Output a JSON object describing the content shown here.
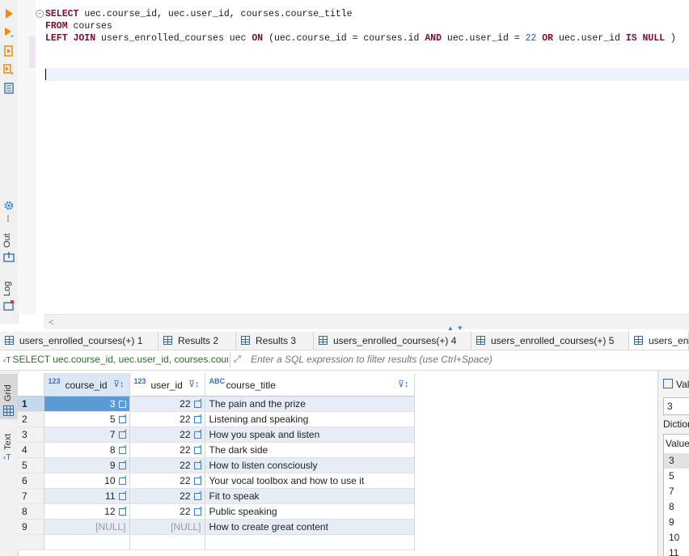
{
  "editor": {
    "sql": [
      {
        "tokens": [
          {
            "t": "SELECT",
            "k": "kw"
          },
          {
            "t": " uec.course_id, uec.user_id, courses.course_title",
            "k": ""
          }
        ]
      },
      {
        "tokens": [
          {
            "t": "FROM",
            "k": "kw"
          },
          {
            "t": " courses",
            "k": ""
          }
        ]
      },
      {
        "tokens": [
          {
            "t": "LEFT JOIN",
            "k": "kw"
          },
          {
            "t": " users_enrolled_courses uec ",
            "k": ""
          },
          {
            "t": "ON",
            "k": "kw"
          },
          {
            "t": " (uec.course_id = courses.id ",
            "k": ""
          },
          {
            "t": "AND",
            "k": "kw"
          },
          {
            "t": " uec.user_id = ",
            "k": ""
          },
          {
            "t": "22",
            "k": "num"
          },
          {
            "t": " ",
            "k": ""
          },
          {
            "t": "OR",
            "k": "kw"
          },
          {
            "t": " uec.user_id ",
            "k": ""
          },
          {
            "t": "IS",
            "k": "kw"
          },
          {
            "t": " ",
            "k": ""
          },
          {
            "t": "NULL",
            "k": "kw"
          },
          {
            "t": " )",
            "k": ""
          }
        ]
      }
    ]
  },
  "side_tools": {
    "out_label": "Out",
    "log_label": "Log"
  },
  "result_tabs": [
    {
      "label": "users_enrolled_courses(+) 1",
      "active": false
    },
    {
      "label": "Results 2",
      "active": false
    },
    {
      "label": "Results 3",
      "active": false
    },
    {
      "label": "users_enrolled_courses(+) 4",
      "active": false
    },
    {
      "label": "users_enrolled_courses(+) 5",
      "active": false
    },
    {
      "label": "users_enro",
      "active": true
    }
  ],
  "filter_bar": {
    "query_text": "SELECT uec.course_id, uec.user_id, courses.course_title",
    "placeholder": "Enter a SQL expression to filter results (use Ctrl+Space)"
  },
  "view_tabs": {
    "grid": "Grid",
    "text": "Text"
  },
  "table": {
    "columns": [
      {
        "name": "course_id",
        "type_badge": "123"
      },
      {
        "name": "user_id",
        "type_badge": "123"
      },
      {
        "name": "course_title",
        "type_badge": "ABC"
      }
    ],
    "rows": [
      {
        "n": "1",
        "course_id": "3",
        "user_id": "22",
        "course_title": "The pain and the prize"
      },
      {
        "n": "2",
        "course_id": "5",
        "user_id": "22",
        "course_title": "Listening and speaking"
      },
      {
        "n": "3",
        "course_id": "7",
        "user_id": "22",
        "course_title": "How you speak and listen"
      },
      {
        "n": "4",
        "course_id": "8",
        "user_id": "22",
        "course_title": "The dark side"
      },
      {
        "n": "5",
        "course_id": "9",
        "user_id": "22",
        "course_title": "How to listen consciously"
      },
      {
        "n": "6",
        "course_id": "10",
        "user_id": "22",
        "course_title": "Your vocal toolbox and how to use it"
      },
      {
        "n": "7",
        "course_id": "11",
        "user_id": "22",
        "course_title": "Fit to speak"
      },
      {
        "n": "8",
        "course_id": "12",
        "user_id": "22",
        "course_title": "Public speaking"
      },
      {
        "n": "9",
        "course_id": "[NULL]",
        "user_id": "[NULL]",
        "course_title": "How to create great content"
      }
    ]
  },
  "value_panel": {
    "title": "Value",
    "value": "3",
    "dictionary_label": "Dictionary",
    "dictionary_header": "Value",
    "items": [
      "3",
      "5",
      "7",
      "8",
      "9",
      "10",
      "11"
    ],
    "selected": "3"
  },
  "colors": {
    "keyword": "#7a0b2a",
    "number": "#1f55c9",
    "selection": "#5b9bd5",
    "alt_row": "#e6edf6"
  }
}
